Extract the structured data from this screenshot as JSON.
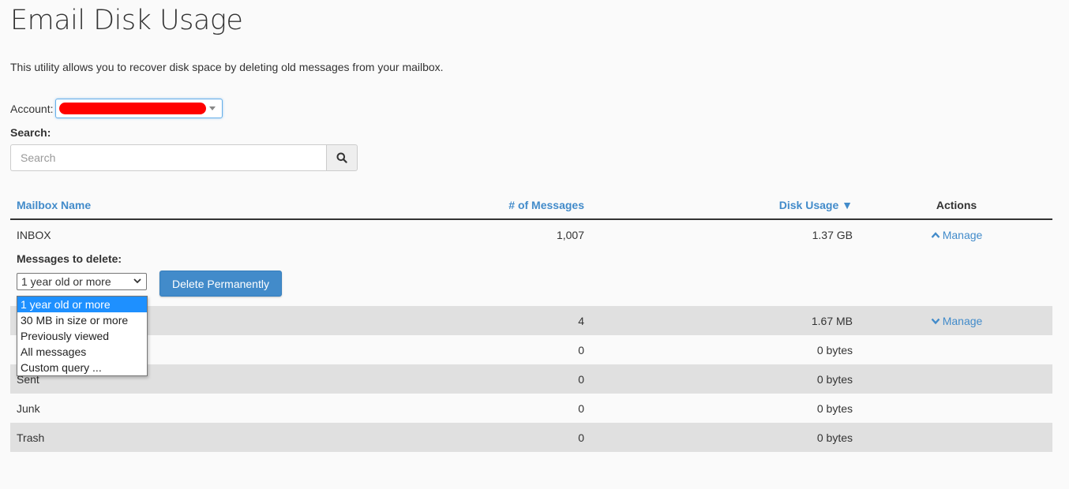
{
  "page": {
    "title": "Email Disk Usage",
    "description": "This utility allows you to recover disk space by deleting old messages from your mailbox."
  },
  "account": {
    "label": "Account:",
    "value_redacted": true
  },
  "search": {
    "label": "Search:",
    "placeholder": "Search",
    "value": "",
    "button_icon": "search-icon"
  },
  "table": {
    "headers": {
      "mailbox_name": "Mailbox Name",
      "messages": "# of Messages",
      "disk_usage": "Disk Usage",
      "sort_indicator": "▼",
      "actions": "Actions"
    },
    "rows": [
      {
        "name": "INBOX",
        "messages": "1,007",
        "disk_usage": "1.37 GB",
        "action": "Manage",
        "action_icon": "chevron-up-icon",
        "expanded": true
      },
      {
        "name": "",
        "messages": "4",
        "disk_usage": "1.67 MB",
        "action": "Manage",
        "action_icon": "chevron-down-icon",
        "expanded": false
      },
      {
        "name": "",
        "messages": "0",
        "disk_usage": "0 bytes",
        "action": "",
        "expanded": false
      },
      {
        "name": "Sent",
        "messages": "0",
        "disk_usage": "0 bytes",
        "action": "",
        "expanded": false
      },
      {
        "name": "Junk",
        "messages": "0",
        "disk_usage": "0 bytes",
        "action": "",
        "expanded": false
      },
      {
        "name": "Trash",
        "messages": "0",
        "disk_usage": "0 bytes",
        "action": "",
        "expanded": false
      }
    ]
  },
  "manage_panel": {
    "label": "Messages to delete:",
    "selected": "1 year old or more",
    "options": [
      "1 year old or more",
      "30 MB in size or more",
      "Previously viewed",
      "All messages",
      "Custom query ..."
    ],
    "delete_button": "Delete Permanently"
  },
  "colors": {
    "link": "#428bca",
    "primary_button": "#428bca",
    "stripe": "#e0e0e0",
    "dropdown_highlight": "#1e90ff",
    "redaction": "#ff0000"
  }
}
